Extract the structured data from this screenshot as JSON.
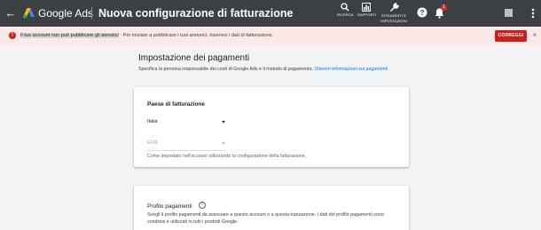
{
  "header": {
    "back_icon": "arrow-back-icon",
    "brand": "Google Ads",
    "title": "Nuova configurazione di fatturazione",
    "search_label": "RICERCA",
    "reports_label": "RAPPORTI",
    "tools_label_line1": "STRUMENTI E",
    "tools_label_line2": "IMPOSTAZIONI",
    "notification_count": "1"
  },
  "alert": {
    "highlighted_text": "Il tuo account non può pubblicare gli annunci",
    "rest_text": " · Per iniziare a pubblicare i tuoi annunci, inserisci i dati di fatturazione.",
    "fix_label": "CORREGGI",
    "close_symbol": "×"
  },
  "payments": {
    "title": "Impostazione dei pagamenti",
    "description": "Specifica la persona responsabile dei costi di Google Ads e il metodo di pagamento.",
    "link": "Ulteriori informazioni sui pagamenti"
  },
  "billing_country_card": {
    "title": "Paese di fatturazione",
    "country_value": "Italia",
    "currency_value": "EUR",
    "note": "Come impostato nell'account utilizzando la configurazione della fatturazione."
  },
  "payments_profile_card": {
    "title": "Profilo pagamenti",
    "description": "Scegli il profilo pagamenti da associare a questo account o a questa transazione. I dati del profilo pagamenti sono condivisi e utilizzati in tutti i prodotti Google."
  },
  "colors": {
    "topbar": "#3c4043",
    "alert_bg": "#fce8e6",
    "error": "#c5221f",
    "link": "#1a73e8",
    "page_bg": "#f1f3f4"
  }
}
